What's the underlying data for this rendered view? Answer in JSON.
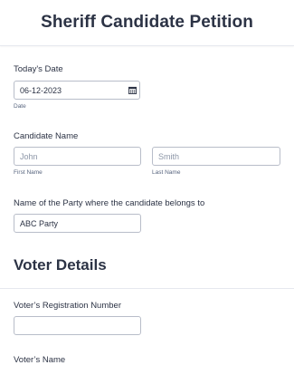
{
  "form": {
    "title": "Sheriff Candidate Petition"
  },
  "date_field": {
    "label": "Today's Date",
    "value": "06-12-2023",
    "sublabel": "Date",
    "icon": "calendar-icon"
  },
  "candidate_name": {
    "label": "Candidate Name",
    "first_placeholder": "John",
    "last_placeholder": "Smith",
    "first_sublabel": "First Name",
    "last_sublabel": "Last Name"
  },
  "party": {
    "label": "Name of the Party where the candidate belongs to",
    "value": "ABC Party"
  },
  "voter_section": {
    "title": "Voter Details",
    "registration_label": "Voter’s Registration Number",
    "registration_value": "",
    "name_label": "Voter’s Name"
  }
}
